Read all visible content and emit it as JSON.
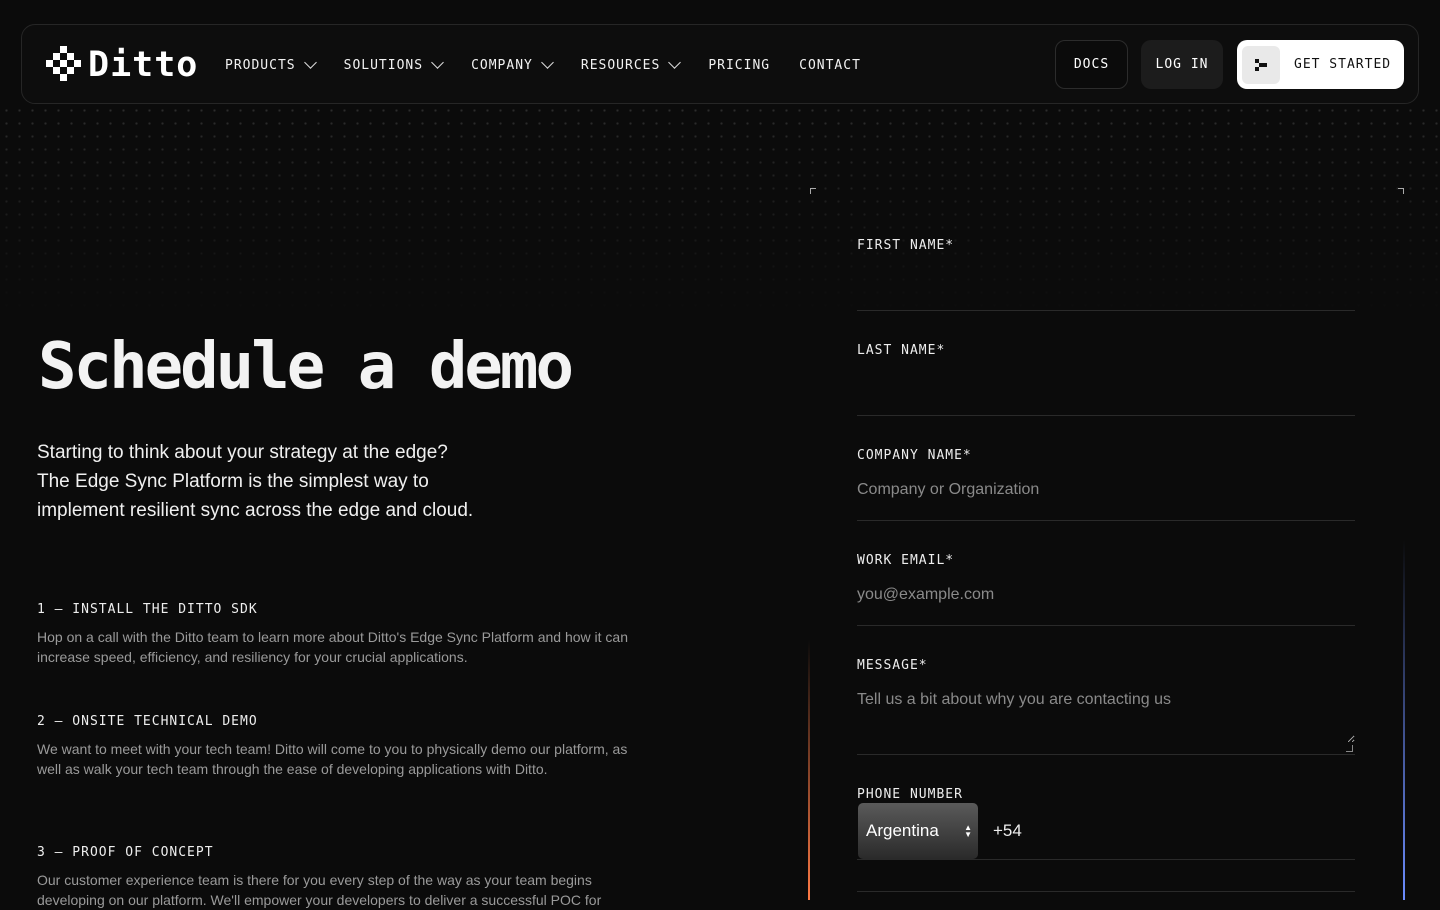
{
  "brand": {
    "name": "Ditto"
  },
  "nav": {
    "items": [
      {
        "label": "PRODUCTS",
        "dropdown": true
      },
      {
        "label": "SOLUTIONS",
        "dropdown": true
      },
      {
        "label": "COMPANY",
        "dropdown": true
      },
      {
        "label": "RESOURCES",
        "dropdown": true
      },
      {
        "label": "PRICING",
        "dropdown": false
      },
      {
        "label": "CONTACT",
        "dropdown": false
      }
    ],
    "docs_label": "DOCS",
    "login_label": "LOG IN",
    "get_started_label": "GET STARTED"
  },
  "hero": {
    "title": "Schedule a demo",
    "intro_lines": [
      "Starting to think about your strategy at the edge?",
      "The Edge Sync Platform is the simplest way to",
      "implement resilient sync across the edge and cloud."
    ]
  },
  "steps": [
    {
      "title": "1 — INSTALL THE DITTO SDK",
      "body": "Hop on a call with the Ditto team to learn more about Ditto's Edge Sync Platform and how it can increase speed, efficiency, and resiliency for your crucial applications."
    },
    {
      "title": "2 — ONSITE TECHNICAL DEMO",
      "body": "We want to meet with your tech team! Ditto will come to you to physically demo our platform, as well as walk your tech team through the ease of developing applications with Ditto."
    },
    {
      "title": "3 — PROOF OF CONCEPT",
      "body": "Our customer experience team is there for you every step of the way as your team begins developing on our platform. We'll empower your developers to deliver a successful POC for"
    }
  ],
  "form": {
    "first_name": {
      "label": "FIRST NAME*",
      "value": "",
      "placeholder": ""
    },
    "last_name": {
      "label": "LAST NAME*",
      "value": "",
      "placeholder": ""
    },
    "company": {
      "label": "COMPANY NAME*",
      "value": "",
      "placeholder": "Company or Organization"
    },
    "email": {
      "label": "WORK EMAIL*",
      "value": "",
      "placeholder": "you@example.com"
    },
    "message": {
      "label": "MESSAGE*",
      "value": "",
      "placeholder": "Tell us a bit about why you are contacting us"
    },
    "phone": {
      "label": "PHONE NUMBER",
      "country": "Argentina",
      "dial_code": "+54"
    }
  },
  "colors": {
    "background": "#0b0b0b",
    "accent_orange": "#ff7a45",
    "accent_blue": "#6c8dff"
  }
}
